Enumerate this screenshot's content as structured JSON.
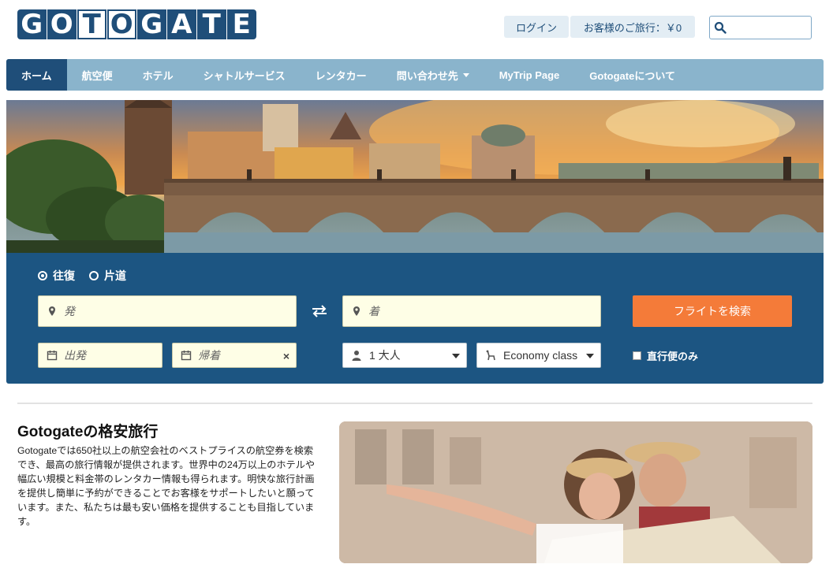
{
  "header": {
    "logo_letters": [
      "G",
      "O",
      "T",
      "O",
      "G",
      "A",
      "T",
      "E"
    ],
    "login_label": "ログイン",
    "trip_label": "お客様のご旅行：￥0",
    "search_placeholder": ""
  },
  "nav": {
    "items": [
      {
        "label": "ホーム"
      },
      {
        "label": "航空便"
      },
      {
        "label": "ホテル"
      },
      {
        "label": "シャトルサービス"
      },
      {
        "label": "レンタカー"
      },
      {
        "label": "問い合わせ先"
      },
      {
        "label": "MyTrip Page"
      },
      {
        "label": "Gotogateについて"
      }
    ]
  },
  "search": {
    "round_trip": "往復",
    "one_way": "片道",
    "from_placeholder": "発",
    "to_placeholder": "着",
    "search_button": "フライトを検索",
    "depart_placeholder": "出発",
    "return_placeholder": "帰着",
    "clear": "×",
    "passengers": "1 大人",
    "cabin_class": "Economy class",
    "direct_only": "直行便のみ"
  },
  "info": {
    "title": "Gotogateの格安旅行",
    "text": "Gotogateでは650社以上の航空会社のベストプライスの航空券を検索でき、最高の旅行情報が提供されます。世界中の24万以上のホテルや幅広い規模と料金帯のレンタカー情報も得られます。明快な旅行計画を提供し簡単に予約ができることでお客様をサポートしたいと願っています。また、私たちは最も安い価格を提供することも目指しています。"
  },
  "colors": {
    "brand": "#1f4e79",
    "nav": "#8ab4cc",
    "panel": "#1c5582",
    "accent": "#f47b39"
  }
}
